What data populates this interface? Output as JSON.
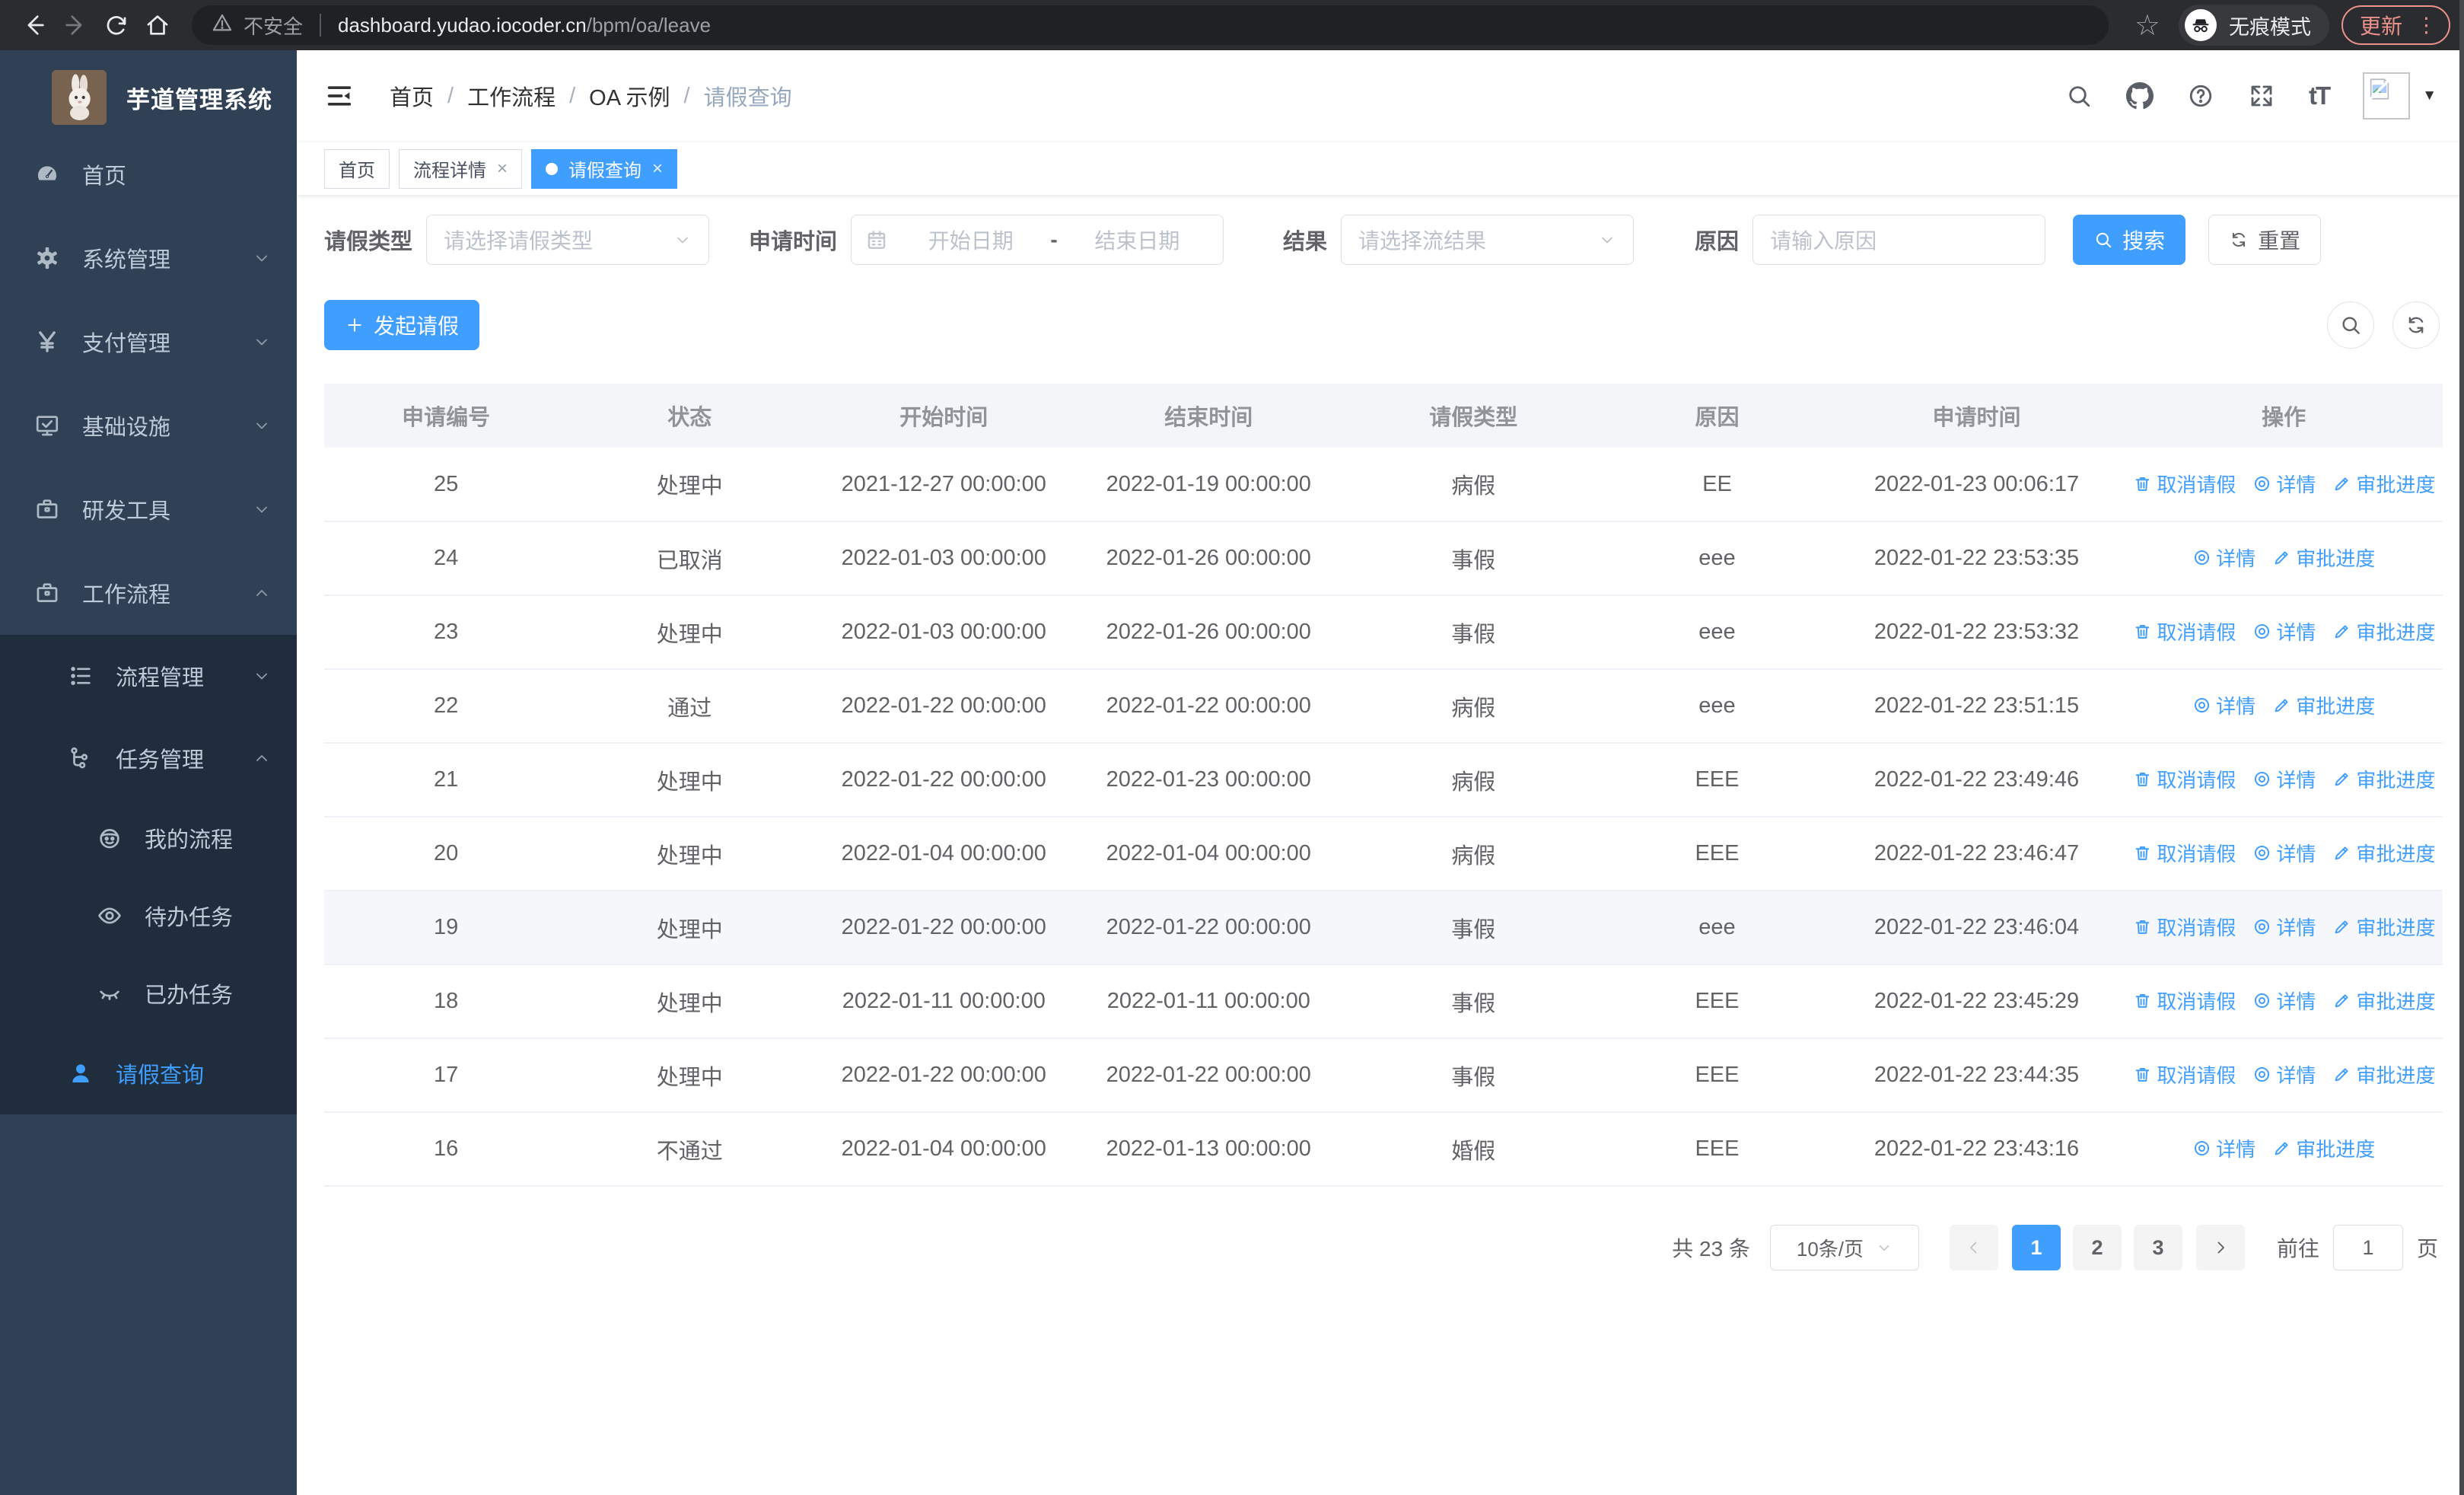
{
  "browser": {
    "security_label": "不安全",
    "url_domain": "dashboard.yudao.iocoder.cn",
    "url_path": "/bpm/oa/leave",
    "incognito_label": "无痕模式",
    "update_label": "更新"
  },
  "sidebar": {
    "title": "芋道管理系统",
    "items": [
      {
        "label": "首页",
        "icon": "dashboard-icon",
        "level": 1
      },
      {
        "label": "系统管理",
        "icon": "gear-icon",
        "level": 1,
        "chevron": "down"
      },
      {
        "label": "支付管理",
        "icon": "yen-icon",
        "level": 1,
        "chevron": "down"
      },
      {
        "label": "基础设施",
        "icon": "monitor-icon",
        "level": 1,
        "chevron": "down"
      },
      {
        "label": "研发工具",
        "icon": "briefcase-icon",
        "level": 1,
        "chevron": "down"
      },
      {
        "label": "工作流程",
        "icon": "briefcase-icon",
        "level": 1,
        "chevron": "up"
      },
      {
        "label": "流程管理",
        "icon": "list-icon",
        "level": 2,
        "chevron": "down",
        "dark": true
      },
      {
        "label": "任务管理",
        "icon": "tree-icon",
        "level": 2,
        "chevron": "up",
        "dark": true
      },
      {
        "label": "我的流程",
        "icon": "robot-icon",
        "level": 3,
        "dark": true
      },
      {
        "label": "待办任务",
        "icon": "eye-icon",
        "level": 3,
        "dark": true
      },
      {
        "label": "已办任务",
        "icon": "eye-closed-icon",
        "level": 3,
        "dark": true
      },
      {
        "label": "请假查询",
        "icon": "user-icon",
        "level": 2,
        "dark": true,
        "active": true
      }
    ]
  },
  "breadcrumb": [
    "首页",
    "工作流程",
    "OA 示例",
    "请假查询"
  ],
  "tabs": [
    {
      "label": "首页"
    },
    {
      "label": "流程详情",
      "closable": true
    },
    {
      "label": "请假查询",
      "closable": true,
      "active": true
    }
  ],
  "filters": {
    "leave_type_label": "请假类型",
    "leave_type_placeholder": "请选择请假类型",
    "apply_time_label": "申请时间",
    "date_start_placeholder": "开始日期",
    "date_separator": "-",
    "date_end_placeholder": "结束日期",
    "result_label": "结果",
    "result_placeholder": "请选择流结果",
    "reason_label": "原因",
    "reason_placeholder": "请输入原因",
    "search_label": "搜索",
    "reset_label": "重置"
  },
  "toolbar": {
    "create_label": "发起请假"
  },
  "table": {
    "columns": [
      "申请编号",
      "状态",
      "开始时间",
      "结束时间",
      "请假类型",
      "原因",
      "申请时间",
      "操作"
    ],
    "action_labels": {
      "cancel": "取消请假",
      "detail": "详情",
      "progress": "审批进度"
    },
    "rows": [
      {
        "id": "25",
        "status": "处理中",
        "start": "2021-12-27 00:00:00",
        "end": "2022-01-19 00:00:00",
        "type": "病假",
        "reason": "EE",
        "applied": "2022-01-23 00:06:17",
        "actions": [
          "cancel",
          "detail",
          "progress"
        ]
      },
      {
        "id": "24",
        "status": "已取消",
        "start": "2022-01-03 00:00:00",
        "end": "2022-01-26 00:00:00",
        "type": "事假",
        "reason": "eee",
        "applied": "2022-01-22 23:53:35",
        "actions": [
          "detail",
          "progress"
        ]
      },
      {
        "id": "23",
        "status": "处理中",
        "start": "2022-01-03 00:00:00",
        "end": "2022-01-26 00:00:00",
        "type": "事假",
        "reason": "eee",
        "applied": "2022-01-22 23:53:32",
        "actions": [
          "cancel",
          "detail",
          "progress"
        ]
      },
      {
        "id": "22",
        "status": "通过",
        "start": "2022-01-22 00:00:00",
        "end": "2022-01-22 00:00:00",
        "type": "病假",
        "reason": "eee",
        "applied": "2022-01-22 23:51:15",
        "actions": [
          "detail",
          "progress"
        ]
      },
      {
        "id": "21",
        "status": "处理中",
        "start": "2022-01-22 00:00:00",
        "end": "2022-01-23 00:00:00",
        "type": "病假",
        "reason": "EEE",
        "applied": "2022-01-22 23:49:46",
        "actions": [
          "cancel",
          "detail",
          "progress"
        ]
      },
      {
        "id": "20",
        "status": "处理中",
        "start": "2022-01-04 00:00:00",
        "end": "2022-01-04 00:00:00",
        "type": "病假",
        "reason": "EEE",
        "applied": "2022-01-22 23:46:47",
        "actions": [
          "cancel",
          "detail",
          "progress"
        ]
      },
      {
        "id": "19",
        "status": "处理中",
        "start": "2022-01-22 00:00:00",
        "end": "2022-01-22 00:00:00",
        "type": "事假",
        "reason": "eee",
        "applied": "2022-01-22 23:46:04",
        "actions": [
          "cancel",
          "detail",
          "progress"
        ],
        "highlight": true
      },
      {
        "id": "18",
        "status": "处理中",
        "start": "2022-01-11 00:00:00",
        "end": "2022-01-11 00:00:00",
        "type": "事假",
        "reason": "EEE",
        "applied": "2022-01-22 23:45:29",
        "actions": [
          "cancel",
          "detail",
          "progress"
        ]
      },
      {
        "id": "17",
        "status": "处理中",
        "start": "2022-01-22 00:00:00",
        "end": "2022-01-22 00:00:00",
        "type": "事假",
        "reason": "EEE",
        "applied": "2022-01-22 23:44:35",
        "actions": [
          "cancel",
          "detail",
          "progress"
        ]
      },
      {
        "id": "16",
        "status": "不通过",
        "start": "2022-01-04 00:00:00",
        "end": "2022-01-13 00:00:00",
        "type": "婚假",
        "reason": "EEE",
        "applied": "2022-01-22 23:43:16",
        "actions": [
          "detail",
          "progress"
        ]
      }
    ]
  },
  "pagination": {
    "total_label": "共 23 条",
    "page_size": "10条/页",
    "pages": [
      "1",
      "2",
      "3"
    ],
    "active_page": "1",
    "goto_label": "前往",
    "goto_value": "1",
    "page_unit": "页"
  },
  "colors": {
    "primary": "#409eff",
    "sidebar_bg": "#304156",
    "submenu_bg": "#1f2d3d",
    "update_accent": "#ec928c"
  }
}
